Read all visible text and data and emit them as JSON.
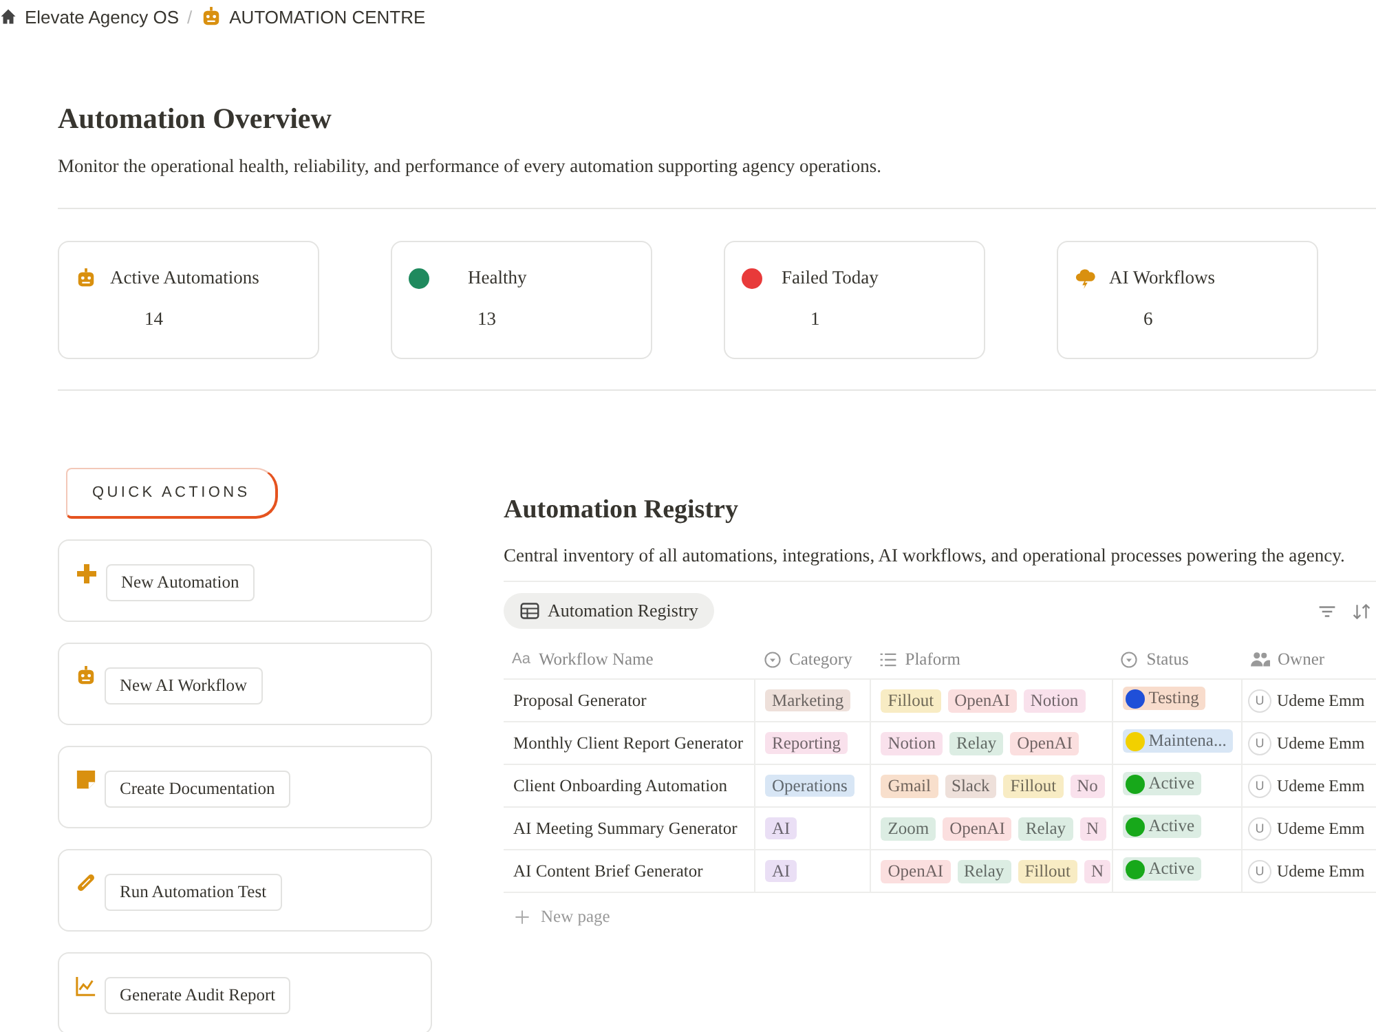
{
  "breadcrumb": [
    {
      "label": "Elevate Agency OS"
    },
    {
      "label": "AUTOMATION CENTRE"
    }
  ],
  "breadcrumb_separator": "/",
  "overview": {
    "title": "Automation Overview",
    "description": "Monitor the operational health, reliability, and performance of every automation supporting agency operations."
  },
  "stats": [
    {
      "label": "Active Automations",
      "value": "14"
    },
    {
      "label": "Healthy",
      "value": "13",
      "color": "#1f8a5e"
    },
    {
      "label": "Failed Today",
      "value": "1",
      "color": "#e83a3a"
    },
    {
      "label": "AI Workflows",
      "value": "6"
    }
  ],
  "quick_actions": {
    "title": "QUICK ACTIONS",
    "items": [
      {
        "label": "New Automation"
      },
      {
        "label": "New AI Workflow"
      },
      {
        "label": "Create Documentation"
      },
      {
        "label": "Run Automation Test"
      },
      {
        "label": "Generate Audit Report"
      }
    ]
  },
  "registry": {
    "title": "Automation Registry",
    "description": "Central inventory of all automations, integrations, AI workflows, and operational processes powering the agency.",
    "view_tab": {
      "label": "Automation Registry",
      "selected": true
    },
    "columns": [
      {
        "label": "Workflow Name",
        "kind": "text",
        "glyph": "Aa"
      },
      {
        "label": "Category",
        "kind": "select"
      },
      {
        "label": "Plaform",
        "kind": "multi"
      },
      {
        "label": "Status",
        "kind": "select"
      },
      {
        "label": "Owner",
        "kind": "person"
      }
    ],
    "rows": [
      {
        "name": "Proposal Generator",
        "category": {
          "label": "Marketing",
          "color": "#eee0da"
        },
        "platforms": [
          {
            "label": "Fillout",
            "color": "#f8ecc4"
          },
          {
            "label": "OpenAI",
            "color": "#fbdfdf"
          },
          {
            "label": "Notion",
            "color": "#f9e1ec"
          }
        ],
        "status": {
          "label": "Testing",
          "kind": "testing",
          "color": "#1f4fd8"
        },
        "owner": {
          "initial": "U",
          "name": "Udeme Emm"
        }
      },
      {
        "name": "Monthly Client Report Generator",
        "category": {
          "label": "Reporting",
          "color": "#f9e1ec"
        },
        "platforms": [
          {
            "label": "Notion",
            "color": "#f9e1ec"
          },
          {
            "label": "Relay",
            "color": "#dcede3"
          },
          {
            "label": "OpenAI",
            "color": "#fbdfdf"
          }
        ],
        "status": {
          "label": "Maintena...",
          "kind": "maintenance",
          "color": "#f2d000"
        },
        "owner": {
          "initial": "U",
          "name": "Udeme Emm"
        }
      },
      {
        "name": "Client Onboarding Automation",
        "category": {
          "label": "Operations",
          "color": "#d8e6f5"
        },
        "platforms": [
          {
            "label": "Gmail",
            "color": "#f8dfcc"
          },
          {
            "label": "Slack",
            "color": "#eee0da"
          },
          {
            "label": "Fillout",
            "color": "#f8ecc4"
          },
          {
            "label": "No",
            "color": "#f9e1ec"
          }
        ],
        "status": {
          "label": "Active",
          "kind": "active",
          "color": "#17a81a"
        },
        "owner": {
          "initial": "U",
          "name": "Udeme Emm"
        }
      },
      {
        "name": "AI Meeting Summary Generator",
        "category": {
          "label": "AI",
          "color": "#eadff5"
        },
        "platforms": [
          {
            "label": "Zoom",
            "color": "#dcede3"
          },
          {
            "label": "OpenAI",
            "color": "#fbdfdf"
          },
          {
            "label": "Relay",
            "color": "#dcede3"
          },
          {
            "label": "N",
            "color": "#f9e1ec"
          }
        ],
        "status": {
          "label": "Active",
          "kind": "active",
          "color": "#17a81a"
        },
        "owner": {
          "initial": "U",
          "name": "Udeme Emm"
        }
      },
      {
        "name": "AI Content Brief Generator",
        "category": {
          "label": "AI",
          "color": "#eadff5"
        },
        "platforms": [
          {
            "label": "OpenAI",
            "color": "#fbdfdf"
          },
          {
            "label": "Relay",
            "color": "#dcede3"
          },
          {
            "label": "Fillout",
            "color": "#f8ecc4"
          },
          {
            "label": "N",
            "color": "#f9e1ec"
          }
        ],
        "status": {
          "label": "Active",
          "kind": "active",
          "color": "#17a81a"
        },
        "owner": {
          "initial": "U",
          "name": "Udeme Emm"
        }
      }
    ],
    "new_page": "New page"
  }
}
